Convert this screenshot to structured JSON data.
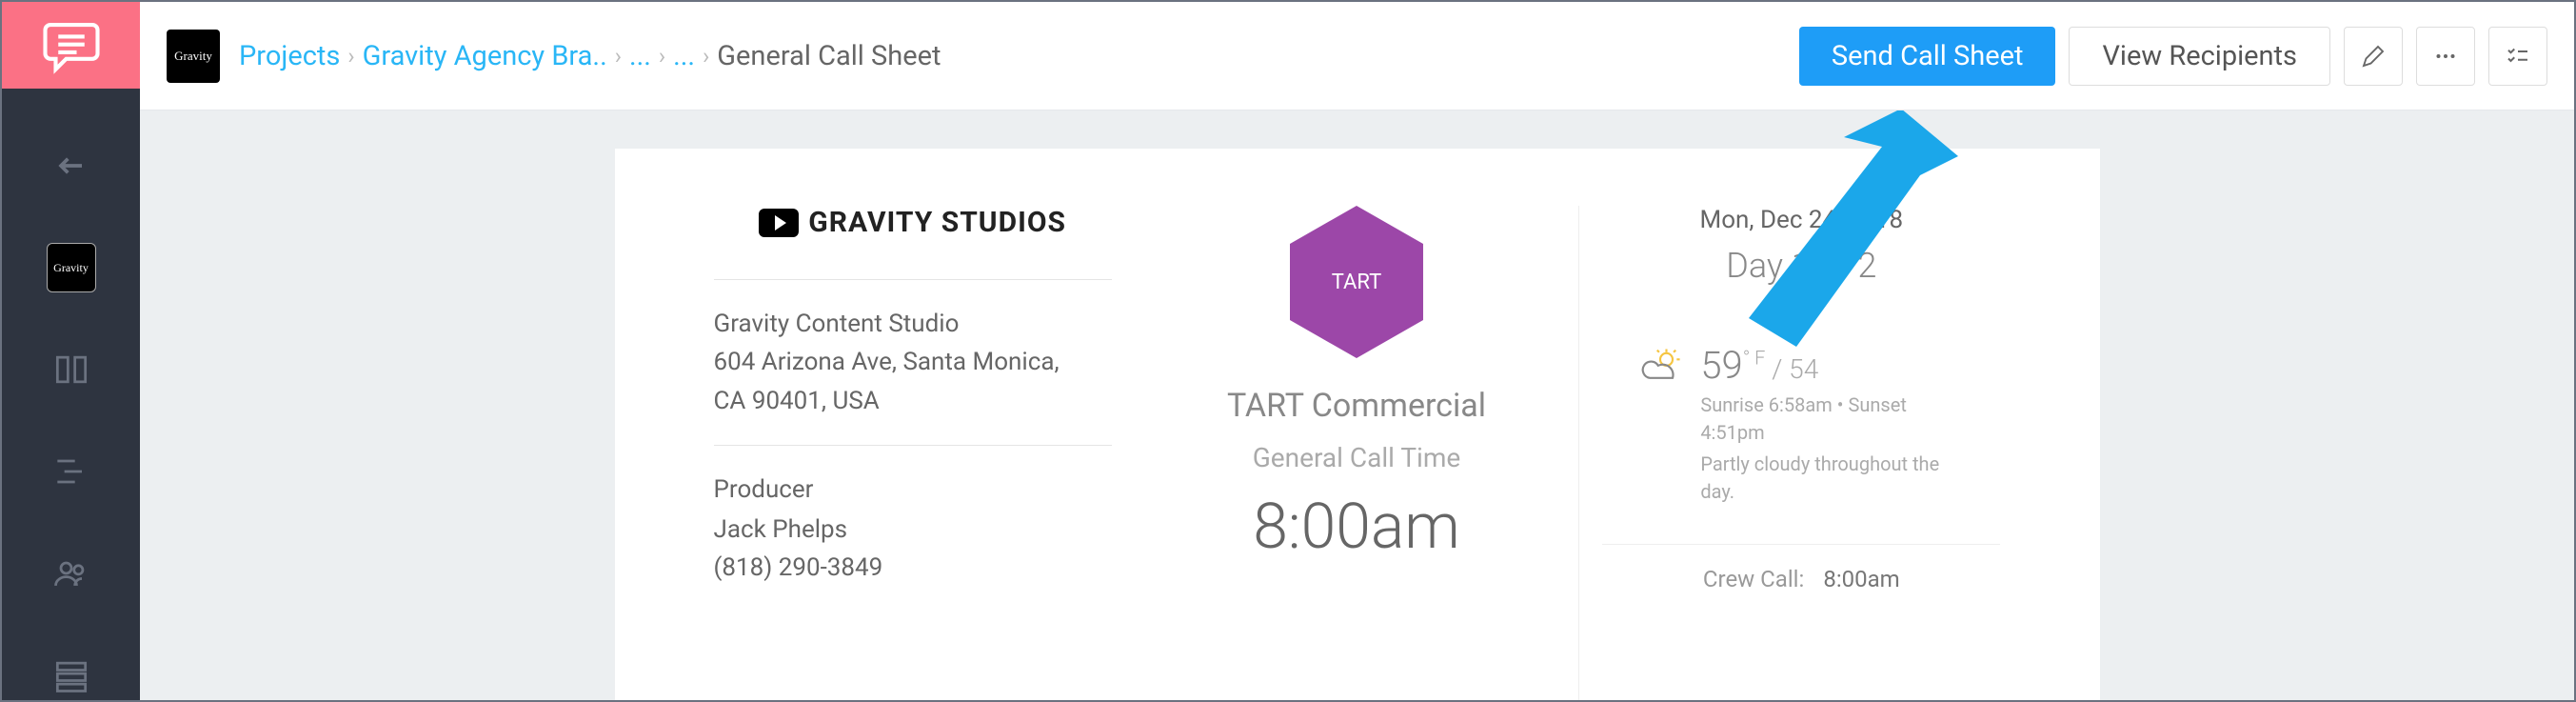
{
  "rail": {
    "nav_back": "back",
    "gravity_label": "Gravity"
  },
  "topbar": {
    "project_icon_label": "Gravity",
    "breadcrumb": {
      "root": "Projects",
      "project": "Gravity Agency Bra..",
      "e1": "...",
      "e2": "...",
      "current": "General Call Sheet"
    },
    "actions": {
      "send": "Send Call Sheet",
      "recipients": "View Recipients"
    }
  },
  "sheet": {
    "studio_name": "GRAVITY STUDIOS",
    "company": {
      "name": "Gravity Content Studio",
      "addr1": "604 Arizona Ave, Santa Monica,",
      "addr2": "CA 90401, USA"
    },
    "producer": {
      "role": "Producer",
      "name": "Jack Phelps",
      "phone": "(818) 290-3849"
    },
    "hex_label": "TART",
    "title": "TART Commercial",
    "call_label": "General Call Time",
    "call_time": "8:00am",
    "date": "Mon, Dec 24, 2018",
    "day_of": "Day 1 of 2",
    "weather": {
      "hi": "59",
      "lo": "54",
      "unit": "° F",
      "line1": "Sunrise 6:58am • Sunset 4:51pm",
      "line2": "Partly cloudy throughout the day."
    },
    "crew": {
      "label": "Crew Call:",
      "time": "8:00am"
    }
  }
}
